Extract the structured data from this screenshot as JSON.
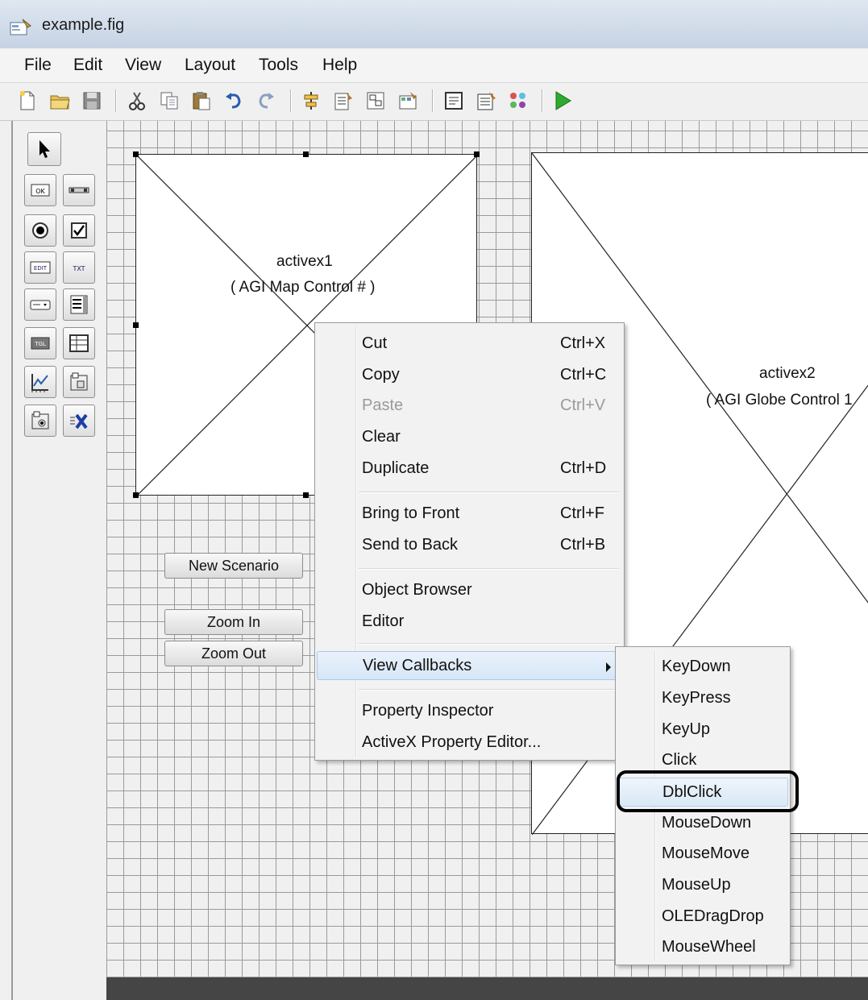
{
  "window": {
    "title": "example.fig"
  },
  "menubar": [
    {
      "label": "File"
    },
    {
      "label": "Edit"
    },
    {
      "label": "View"
    },
    {
      "label": "Layout"
    },
    {
      "label": "Tools"
    },
    {
      "label": "Help"
    }
  ],
  "toolbar": {
    "icons": [
      "new-file-icon",
      "open-folder-icon",
      "save-icon",
      "cut-icon",
      "copy-icon",
      "paste-icon",
      "undo-icon",
      "redo-icon",
      "align-objects-icon",
      "menu-editor-icon",
      "tab-order-editor-icon",
      "toolbar-editor-icon",
      "m-file-editor-icon",
      "property-inspector-icon",
      "object-browser-icon",
      "run-figure-icon"
    ]
  },
  "palette": {
    "items": [
      "select-tool-icon",
      "push-button-tool",
      "slider-tool",
      "radio-button-tool",
      "checkbox-tool",
      "edit-text-tool",
      "static-text-tool",
      "popup-menu-tool",
      "listbox-tool",
      "toggle-button-tool",
      "table-tool",
      "axes-tool",
      "panel-tool",
      "button-group-tool",
      "activex-control-tool"
    ],
    "labels": {
      "ok": "OK",
      "edit": "EDIT",
      "txt": "TXT",
      "tgl": "TGL"
    }
  },
  "canvas": {
    "activex1": {
      "name": "activex1",
      "type": "( AGI Map Control # )"
    },
    "activex2": {
      "name": "activex2",
      "type": "( AGI Globe Control 1"
    },
    "buttons": {
      "new_scenario": "New Scenario",
      "zoom_in": "Zoom In",
      "zoom_out": "Zoom Out"
    }
  },
  "context_menu": {
    "items": [
      {
        "label": "Cut",
        "shortcut": "Ctrl+X"
      },
      {
        "label": "Copy",
        "shortcut": "Ctrl+C"
      },
      {
        "label": "Paste",
        "shortcut": "Ctrl+V"
      },
      {
        "label": "Clear",
        "shortcut": ""
      },
      {
        "label": "Duplicate",
        "shortcut": "Ctrl+D"
      },
      {
        "label": "Bring to Front",
        "shortcut": "Ctrl+F"
      },
      {
        "label": "Send to Back",
        "shortcut": "Ctrl+B"
      },
      {
        "label": "Object Browser",
        "shortcut": ""
      },
      {
        "label": "Editor",
        "shortcut": ""
      },
      {
        "label": "View Callbacks",
        "shortcut": ""
      },
      {
        "label": "Property Inspector",
        "shortcut": ""
      },
      {
        "label": "ActiveX Property Editor...",
        "shortcut": ""
      }
    ]
  },
  "submenu": {
    "items": [
      "KeyDown",
      "KeyPress",
      "KeyUp",
      "Click",
      "DblClick",
      "MouseDown",
      "MouseMove",
      "MouseUp",
      "OLEDragDrop",
      "MouseWheel"
    ],
    "selected": "DblClick"
  },
  "colors": {
    "highlight": "#d6e6f7",
    "grid": "#9a9a9a",
    "disabled_text": "#9a9a9a"
  }
}
